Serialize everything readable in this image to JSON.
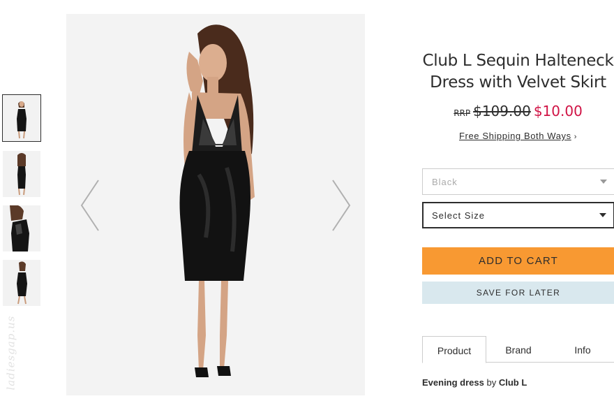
{
  "product": {
    "title": "Club L Sequin Halteneck Dress with Velvet Skirt",
    "rrp_label": "RRP",
    "old_price": "$109.00",
    "new_price": "$10.00",
    "shipping_text": "Free Shipping Both Ways",
    "shipping_chevron": "›",
    "colors": {
      "sale": "#d01345",
      "cart": "#f89932",
      "later": "#d9e8ee"
    }
  },
  "options": {
    "colour_value": "Black",
    "size_placeholder": "Select Size"
  },
  "buttons": {
    "add_to_cart": "ADD TO CART",
    "save_for_later": "SAVE FOR LATER"
  },
  "tabs": [
    {
      "label": "Product",
      "active": true
    },
    {
      "label": "Brand",
      "active": false
    },
    {
      "label": "Info",
      "active": false
    }
  ],
  "description": {
    "category": "Evening dress",
    "by": "by",
    "brand": "Club L"
  },
  "gallery": {
    "thumbnails": 4,
    "selected": 1,
    "watermark": "ladiesgap.us"
  }
}
